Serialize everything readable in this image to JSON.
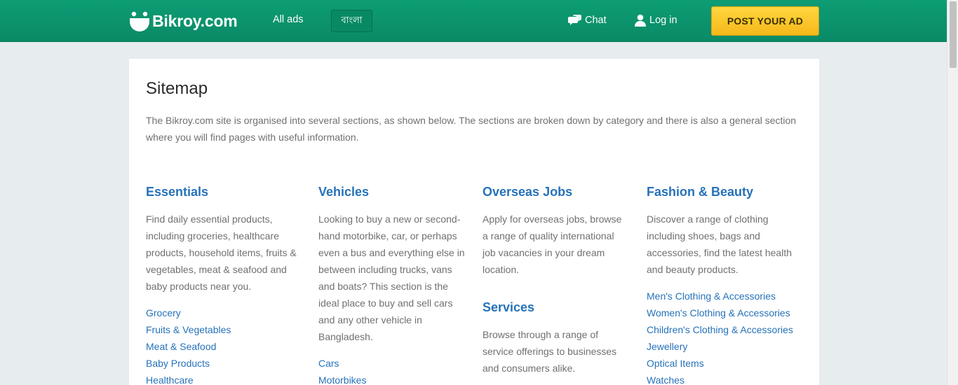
{
  "header": {
    "brand": "Bikroy.com",
    "nav_all_ads": "All ads",
    "nav_language": "বাংলা",
    "nav_chat": "Chat",
    "nav_login": "Log in",
    "post_ad": "POST YOUR AD",
    "colors": {
      "bar": "#0d9d74",
      "button": "#ffc62b"
    }
  },
  "page": {
    "title": "Sitemap",
    "intro": "The Bikroy.com site is organised into several sections, as shown below. The sections are broken down by category and there is also a general section where you will find pages with useful information."
  },
  "columns": [
    {
      "sections": [
        {
          "title": "Essentials",
          "description": "Find daily essential products, including groceries, healthcare products, household items, fruits & vegetables, meat & seafood and baby products near you.",
          "links": [
            "Grocery",
            "Fruits & Vegetables",
            "Meat & Seafood",
            "Baby Products",
            "Healthcare"
          ]
        }
      ]
    },
    {
      "sections": [
        {
          "title": "Vehicles",
          "description": "Looking to buy a new or second-hand motorbike, car, or perhaps even a bus and everything else in between including trucks, vans and boats? This section is the ideal place to buy and sell cars and any other vehicle in Bangladesh.",
          "links": [
            "Cars",
            "Motorbikes"
          ]
        }
      ]
    },
    {
      "sections": [
        {
          "title": "Overseas Jobs",
          "description": "Apply for overseas jobs, browse a range of quality international job vacancies in your dream location.",
          "links": []
        },
        {
          "title": "Services",
          "description": "Browse through a range of service offerings to businesses and consumers alike.",
          "links": []
        }
      ]
    },
    {
      "sections": [
        {
          "title": "Fashion & Beauty",
          "description": "Discover a range of clothing including shoes, bags and accessories, find the latest health and beauty products.",
          "links": [
            "Men's Clothing & Accessories",
            "Women's Clothing & Accessories",
            "Children's Clothing & Accessories",
            "Jewellery",
            "Optical Items",
            "Watches"
          ]
        }
      ]
    }
  ]
}
